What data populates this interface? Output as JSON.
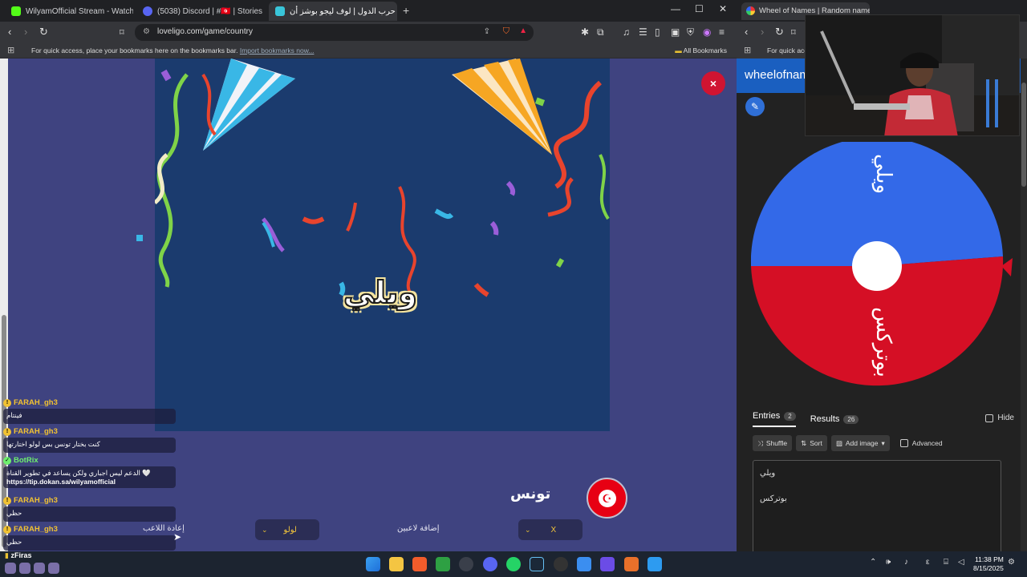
{
  "left_browser": {
    "tabs": [
      {
        "title": "WilyamOfficial Stream - Watch Live o",
        "active": false
      },
      {
        "title": "(5038) Discord | #🇹🇳 | Stories | WM",
        "active": false
      },
      {
        "title": "لعبة حرب الدول | لوف ليجو بوشز أن",
        "active": true
      }
    ],
    "url": "loveligo.com/game/country",
    "bookmarks_hint": "For quick access, place your bookmarks here on the bookmarks bar.",
    "bookmarks_link": "Import bookmarks now...",
    "all_bookmarks": "All Bookmarks"
  },
  "game": {
    "winner_name": "ويلي",
    "close_label": "×",
    "country_name": "تونس",
    "flag_symbol": "☪",
    "reset_label": "إعادة اللاعب",
    "add_player_label": "إضافة لاعبين",
    "player_select_value": "لولو",
    "x_select_value": "X"
  },
  "chat": [
    {
      "user": "FARAH_gh3",
      "text": "فينتام"
    },
    {
      "user": "FARAH_gh3",
      "text": "كنت بختار تونس بس لولو اختارتها"
    },
    {
      "user": "BotRix",
      "text": "الدعم ليس اجباري ولكن يساعد في تطوير القناة 🤍",
      "link": "https://tip.dokan.sa/wilyamofficial"
    },
    {
      "user": "FARAH_gh3",
      "text": "حظي"
    },
    {
      "user": "FARAH_gh3",
      "text": "حظي"
    }
  ],
  "chat_footer_user": "zFiras",
  "right_browser": {
    "tab_title": "Wheel of Names | Random name",
    "bookmarks_hint": "For quick acc",
    "site_title": "wheelofnam",
    "wheel": {
      "segments": [
        {
          "label": "ويلي",
          "color": "#3369e8"
        },
        {
          "label": "بوتركس",
          "color": "#d50f25"
        }
      ]
    },
    "tabs": [
      {
        "label": "Entries",
        "count": "2"
      },
      {
        "label": "Results",
        "count": "26"
      }
    ],
    "hide_label": "Hide",
    "shuffle_label": "Shuffle",
    "sort_label": "Sort",
    "add_image_label": "Add image",
    "advanced_label": "Advanced",
    "entries": [
      "ويلي",
      "بوتركس"
    ]
  },
  "taskbar": {
    "time": "11:38 PM",
    "date": "8/15/2025"
  }
}
